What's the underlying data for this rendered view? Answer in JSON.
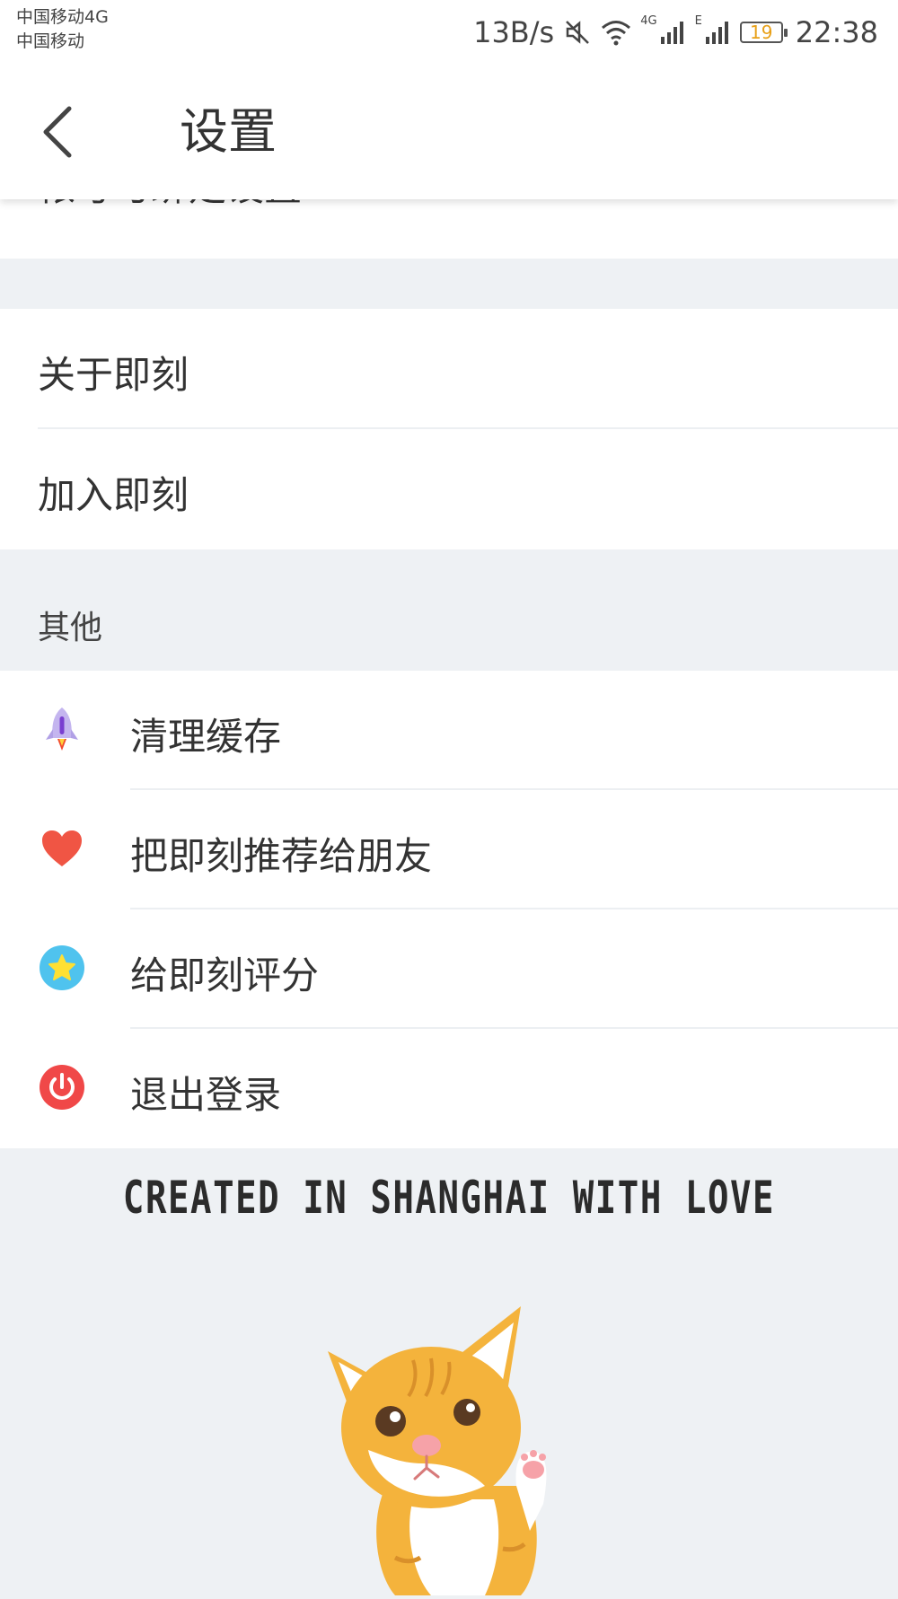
{
  "status_bar": {
    "carrier_1": "中国移动4G",
    "carrier_2": "中国移动",
    "net_speed": "13B/s",
    "net_tag_1": "4G",
    "net_tag_2": "E",
    "battery": "19",
    "time": "22:38",
    "icons": [
      "mute-icon",
      "wifi-icon",
      "signal-icon",
      "signal-icon",
      "battery-icon"
    ]
  },
  "header": {
    "title": "设置",
    "back_icon": "back-arrow-icon"
  },
  "account": {
    "partial_label": "帐号与绑定设置"
  },
  "about_group": {
    "items": [
      {
        "label": "关于即刻"
      },
      {
        "label": "加入即刻"
      }
    ]
  },
  "other_section": {
    "label": "其他",
    "items": [
      {
        "label": "清理缓存",
        "icon": "rocket-icon"
      },
      {
        "label": "把即刻推荐给朋友",
        "icon": "heart-icon"
      },
      {
        "label": "给即刻评分",
        "icon": "star-icon"
      },
      {
        "label": "退出登录",
        "icon": "power-icon"
      }
    ]
  },
  "footer": {
    "tagline": "CREATED IN SHANGHAI WITH LOVE",
    "mascot": "cat-mascot"
  },
  "colors": {
    "background": "#eef1f4",
    "heart": "#f05544",
    "star_bg": "#4fc3ee",
    "star": "#ffe033",
    "power": "#f04848",
    "rocket": "#b9a6e8",
    "cat": "#f4b33c"
  }
}
